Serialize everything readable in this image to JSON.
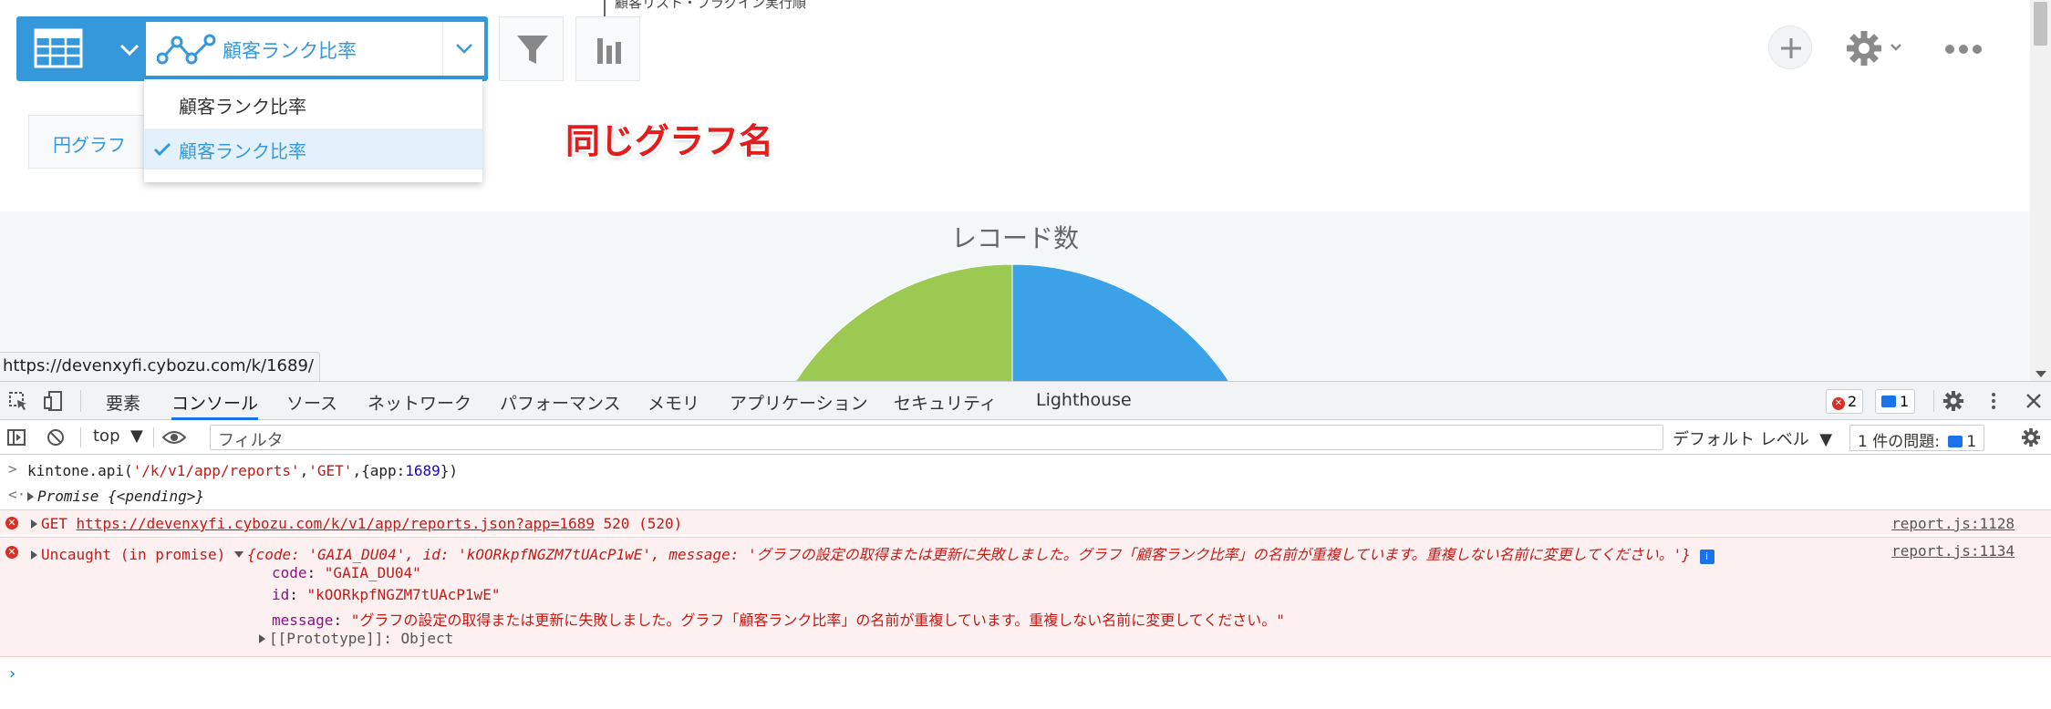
{
  "header": {
    "breadcrumb": "顧客リスト・プラグイン実行順",
    "graph_select": {
      "value": "顧客ランク比率"
    },
    "dropdown": {
      "items": [
        {
          "label": "顧客ランク比率",
          "selected": false
        },
        {
          "label": "顧客ランク比率",
          "selected": true
        }
      ]
    },
    "chart_type_label": "円グラフ",
    "icons": [
      "table-view-icon",
      "chevron-down-icon",
      "line-chart-icon",
      "filter-icon",
      "bar-chart-icon",
      "plus-icon",
      "gear-icon",
      "more-icon"
    ]
  },
  "annotation": "同じグラフ名",
  "chart": {
    "title": "レコード数",
    "colors": {
      "slice1": "#3ba2e8",
      "slice2": "#9bc952"
    }
  },
  "status_url": "https://devenxyfi.cybozu.com/k/1689/",
  "devtools": {
    "tabs": [
      "要素",
      "コンソール",
      "ソース",
      "ネットワーク",
      "パフォーマンス",
      "メモリ",
      "アプリケーション",
      "セキュリティ",
      "Lighthouse"
    ],
    "active_tab": "コンソール",
    "error_count": "2",
    "message_count": "1",
    "context": "top",
    "filter_placeholder": "フィルタ",
    "level": "デフォルト レベル",
    "issues_label": "1 件の問題:",
    "issues_count": "1"
  },
  "console": {
    "cmd_prefix": "kintone.api(",
    "cmd_arg1": "'/k/v1/app/reports'",
    "cmd_arg2": "'GET'",
    "cmd_arg3_open": "{app:",
    "cmd_arg3_num": "1689",
    "cmd_arg3_close": "})",
    "comma": ",",
    "promise": "Promise {<pending>}",
    "get_method": "GET",
    "get_url": "https://devenxyfi.cybozu.com/k/v1/app/reports.json?app=1689",
    "get_status": "520 (520)",
    "get_source": "report.js:1128",
    "uncaught_label": "Uncaught (in promise)",
    "uncaught_summary": "{code: 'GAIA_DU04', id: 'kOORkpfNGZM7tUAcP1wE', message: 'グラフの設定の取得または更新に失敗しました。グラフ「顧客ランク比率」の名前が重複しています。重複しない名前に変更してください。'}",
    "uncaught_source": "report.js:1134",
    "fields": [
      {
        "key": "code",
        "value": "\"GAIA_DU04\""
      },
      {
        "key": "id",
        "value": "\"kOORkpfNGZM7tUAcP1wE\""
      },
      {
        "key": "message",
        "value": "\"グラフの設定の取得または更新に失敗しました。グラフ「顧客ランク比率」の名前が重複しています。重複しない名前に変更してください。\""
      }
    ],
    "prototype": "[[Prototype]]: Object"
  }
}
